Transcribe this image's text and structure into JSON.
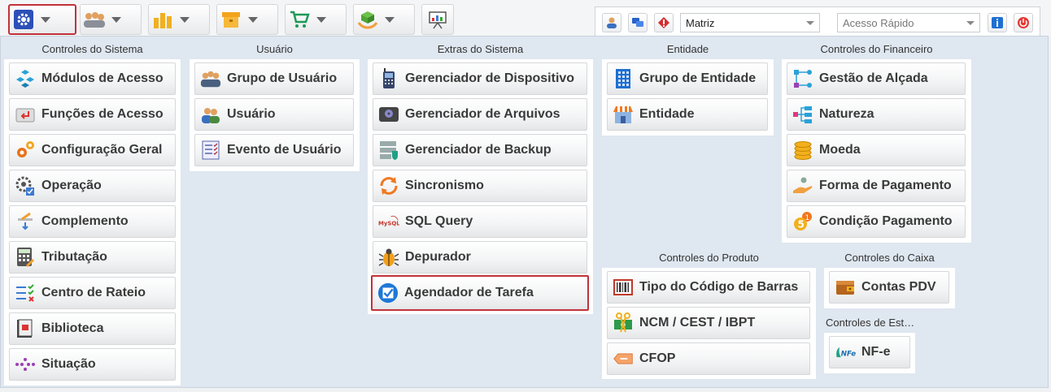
{
  "toolbar": {
    "matriz_value": "Matriz",
    "acesso_rapido_placeholder": "Acesso Rápido"
  },
  "sections": {
    "sistema": {
      "title": "Controles do Sistema",
      "items": [
        "Módulos de Acesso",
        "Funções de Acesso",
        "Configuração Geral",
        "Operação",
        "Complemento",
        "Tributação",
        "Centro de Rateio",
        "Biblioteca",
        "Situação"
      ]
    },
    "usuario": {
      "title": "Usuário",
      "items": [
        "Grupo de Usuário",
        "Usuário",
        "Evento de Usuário"
      ]
    },
    "extras": {
      "title": "Extras do Sistema",
      "items": [
        "Gerenciador de Dispositivo",
        "Gerenciador de Arquivos",
        "Gerenciador de Backup",
        "Sincronismo",
        "SQL Query",
        "Depurador",
        "Agendador de Tarefa"
      ]
    },
    "entidade": {
      "title": "Entidade",
      "items": [
        "Grupo de Entidade",
        "Entidade"
      ]
    },
    "financeiro": {
      "title": "Controles do Financeiro",
      "items": [
        "Gestão de Alçada",
        "Natureza",
        "Moeda",
        "Forma de Pagamento",
        "Condição Pagamento"
      ]
    },
    "produto": {
      "title": "Controles do Produto",
      "items": [
        "Tipo do Código de Barras",
        "NCM / CEST / IBPT",
        "CFOP"
      ]
    },
    "caixa": {
      "title": "Controles do Caixa",
      "items": [
        "Contas PDV"
      ]
    },
    "estoque": {
      "title": "Controles de Est…",
      "items": [
        "NF-e"
      ]
    }
  }
}
